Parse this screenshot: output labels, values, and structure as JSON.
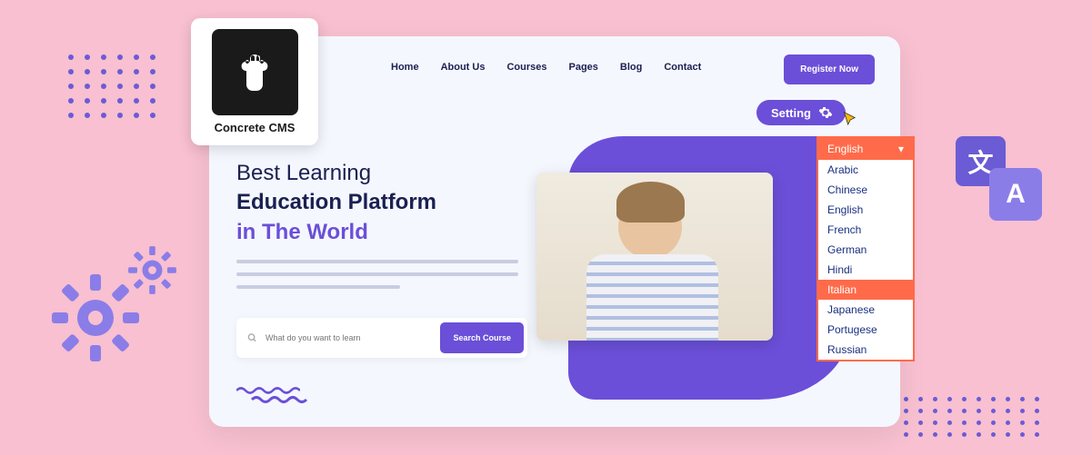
{
  "logo": {
    "name": "Concrete CMS"
  },
  "nav": {
    "items": [
      "Home",
      "About Us",
      "Courses",
      "Pages",
      "Blog",
      "Contact"
    ]
  },
  "cta": {
    "register": "Register Now"
  },
  "setting": {
    "label": "Setting"
  },
  "hero": {
    "line1": "Best Learning",
    "line2": "Education Platform",
    "line3": "in The World"
  },
  "search": {
    "placeholder": "What do you want to learn",
    "button": "Search Course"
  },
  "language_dropdown": {
    "selected": "English",
    "options": [
      "Arabic",
      "Chinese",
      "English",
      "French",
      "German",
      "Hindi",
      "Italian",
      "Japanese",
      "Portugese",
      "Russian"
    ],
    "highlighted": "Italian"
  },
  "icons": {
    "translate1": "文",
    "translate2": "A"
  },
  "colors": {
    "bg": "#f8c0d0",
    "primary": "#6b4fd8",
    "accent": "#ff6b4a",
    "yellow": "#ffb800"
  }
}
